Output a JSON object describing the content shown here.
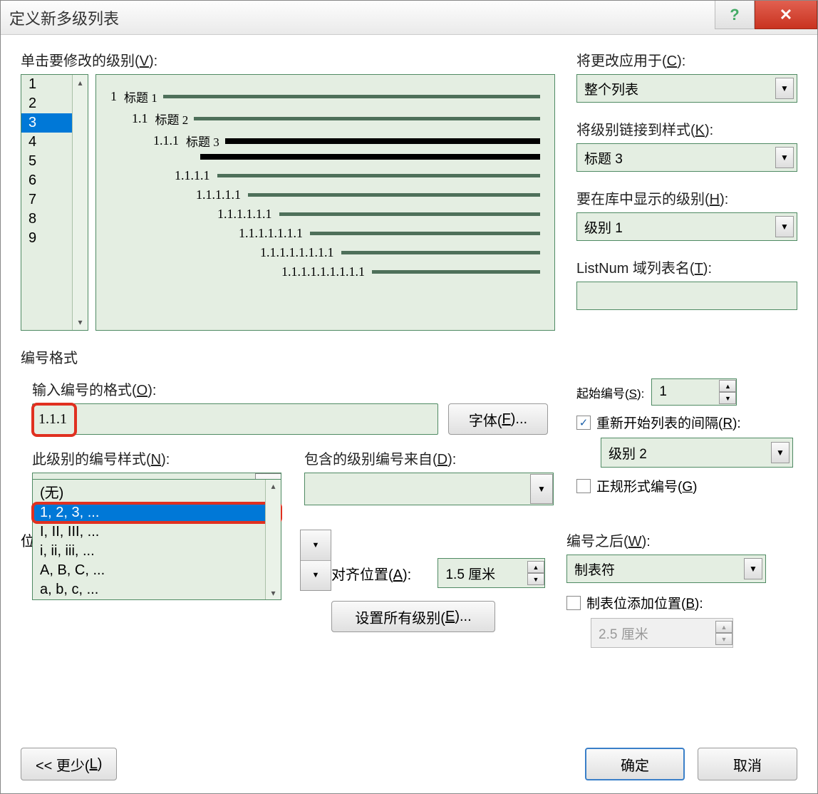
{
  "title": "定义新多级列表",
  "titlebar": {
    "help": "?",
    "close": "✕"
  },
  "labels": {
    "clickLevel": "单击要修改的级别(",
    "clickLevel_key": "V",
    "clickLevel_end": "):",
    "applyChanges": "将更改应用于(",
    "applyChanges_key": "C",
    "applyChanges_end": "):",
    "linkStyle": "将级别链接到样式(",
    "linkStyle_key": "K",
    "linkStyle_end": "):",
    "showInGallery": "要在库中显示的级别(",
    "showInGallery_key": "H",
    "showInGallery_end": "):",
    "listNum": "ListNum 域列表名(",
    "listNum_key": "T",
    "listNum_end": "):",
    "numberFormat": "编号格式",
    "enterFormat": "输入编号的格式(",
    "enterFormat_key": "O",
    "enterFormat_end": "):",
    "fontButton": "字体(",
    "fontButton_key": "F",
    "fontButton_end": ")...",
    "numberStyle": "此级别的编号样式(",
    "numberStyle_key": "N",
    "numberStyle_end": "):",
    "includeFrom": "包含的级别编号来自(",
    "includeFrom_key": "D",
    "includeFrom_end": "):",
    "startAt": "起始编号(",
    "startAt_key": "S",
    "startAt_end": "):",
    "restart": "重新开始列表的间隔(",
    "restart_key": "R",
    "restart_end": "):",
    "legalFormat": "正规形式编号(",
    "legalFormat_key": "G",
    "legalFormat_end": ")",
    "position": "位",
    "alignAt": "对齐位置(",
    "alignAt_key": "A",
    "alignAt_end": "):",
    "followedBy": "编号之后(",
    "followedBy_key": "W",
    "followedBy_end": "):",
    "setAll": "设置所有级别(",
    "setAll_key": "E",
    "setAll_end": ")...",
    "tabStop": "制表位添加位置(",
    "tabStop_key": "B",
    "tabStop_end": "):",
    "less": "<< 更少(",
    "less_key": "L",
    "less_end": ")",
    "ok": "确定",
    "cancel": "取消"
  },
  "levels": [
    "1",
    "2",
    "3",
    "4",
    "5",
    "6",
    "7",
    "8",
    "9"
  ],
  "selectedLevel": 2,
  "preview": {
    "lines": [
      {
        "indent": 0,
        "num": "1",
        "heading": "标题 1"
      },
      {
        "indent": 1,
        "num": "1.1",
        "heading": "标题 2"
      },
      {
        "indent": 2,
        "num": "1.1.1",
        "heading": "标题 3",
        "bold": true
      },
      {
        "indent": 3,
        "standalone": true
      },
      {
        "indent": 3,
        "num": "1.1.1.1"
      },
      {
        "indent": 4,
        "num": "1.1.1.1.1"
      },
      {
        "indent": 5,
        "num": "1.1.1.1.1.1"
      },
      {
        "indent": 6,
        "num": "1.1.1.1.1.1.1"
      },
      {
        "indent": 7,
        "num": "1.1.1.1.1.1.1.1"
      },
      {
        "indent": 8,
        "num": "1.1.1.1.1.1.1.1.1"
      }
    ]
  },
  "values": {
    "applyChanges": "整个列表",
    "linkStyle": "标题 3",
    "showInGallery": "级别 1",
    "listNum": "",
    "numberFormat": "1.1.1",
    "numberStyle": "1, 2, 3, ...",
    "startAt": "1",
    "restartAfter": "级别 2",
    "restartChecked": true,
    "legalChecked": false,
    "alignAt": "1.5 厘米",
    "followedBy": "制表符",
    "tabStopChecked": false,
    "tabStopAt": "2.5 厘米"
  },
  "numberStyleOptions": [
    "(无)",
    "1, 2, 3, ...",
    "I, II, III, ...",
    "i, ii, iii, ...",
    "A, B, C, ...",
    "a, b, c, ..."
  ],
  "numberStyleSelected": 1
}
